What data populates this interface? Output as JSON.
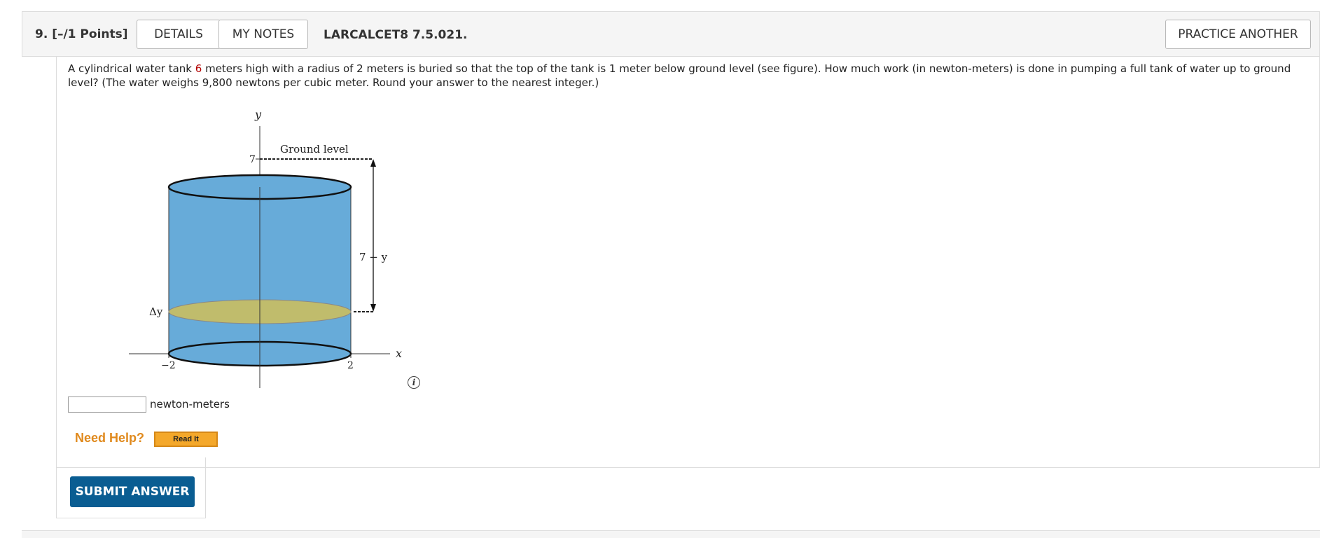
{
  "question": {
    "number": "9.  [–/1 Points]",
    "details_label": "DETAILS",
    "notes_label": "MY NOTES",
    "source": "LARCALCET8 7.5.021.",
    "practice_label": "PRACTICE ANOTHER"
  },
  "problem": {
    "text_before": "A cylindrical water tank ",
    "highlight": "6",
    "text_after": " meters high with a radius of 2 meters is buried so that the top of the tank is 1 meter below ground level (see figure). How much work (in newton-meters) is done in pumping a full tank of water up to ground level? (The water weighs 9,800 newtons per cubic meter. Round your answer to the nearest integer.)"
  },
  "figure": {
    "y_axis_label": "y",
    "x_axis_label": "x",
    "ground_label": "Ground level",
    "tick_7": "7",
    "distance_label": "7 − y",
    "delta_label": "Δy",
    "x_tick_neg": "−2",
    "x_tick_pos": "2",
    "info_icon": "i",
    "water_color": "#67abd9",
    "slice_color": "#c0bc6c"
  },
  "answer": {
    "value": "",
    "units": "newton-meters"
  },
  "help": {
    "label": "Need Help?",
    "read_it": "Read It"
  },
  "submit_label": "SUBMIT ANSWER"
}
